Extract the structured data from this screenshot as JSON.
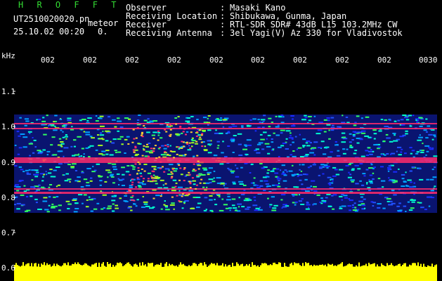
{
  "header": {
    "brand": "H R O F F T",
    "file_name": "UT2510020020.pn",
    "file_suffix": "meteor",
    "datetime": "25.10.02 00:20",
    "count": "0."
  },
  "info": {
    "rows": [
      {
        "label": "Observer",
        "value": "Masaki Kano"
      },
      {
        "label": "Receiving Location",
        "value": "Shibukawa, Gunma, Japan"
      },
      {
        "label": "Receiver",
        "value": "RTL-SDR SDR# 43dB L15 103.2MHz CW"
      },
      {
        "label": "Receiving Antenna",
        "value": "3el Yagi(V) Az 330 for Vladivostok"
      }
    ]
  },
  "axis": {
    "unit": "kHz",
    "y_ticks": [
      "1.1",
      "1.0",
      "0.9",
      "0.8",
      "0.7",
      "0.6"
    ],
    "x_ticks": [
      "002",
      "002",
      "002",
      "002",
      "002",
      "002",
      "002",
      "002",
      "002",
      "0030"
    ]
  },
  "colors": {
    "background": "#000000",
    "signal_peak": "#ff2a6a",
    "noise_low": "#1a2cff",
    "noise_mid": "#00ffd0",
    "level_bar": "#ffff00"
  }
}
